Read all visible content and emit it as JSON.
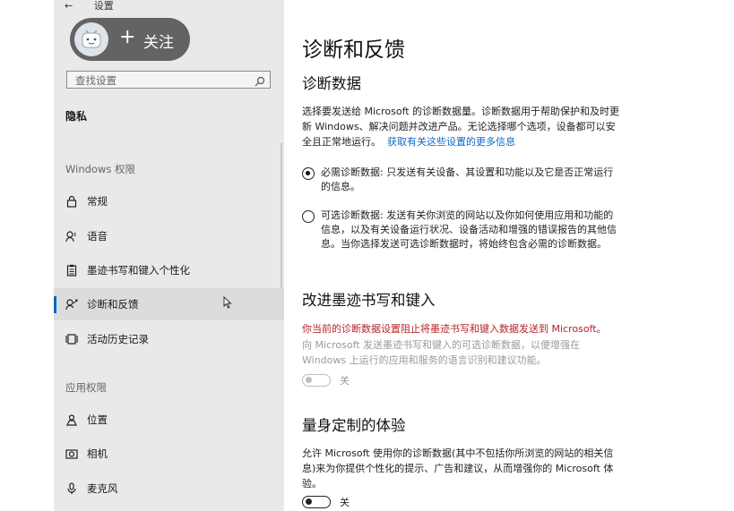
{
  "window": {
    "back_icon": "back-arrow-icon",
    "title": "设置"
  },
  "overlay": {
    "plus": "+",
    "follow_label": "关注"
  },
  "sidebar": {
    "search_placeholder": "查找设置",
    "privacy_label": "隐私",
    "windows_permissions_heading": "Windows 权限",
    "app_permissions_heading": "应用权限",
    "items": [
      {
        "label": "常规",
        "icon": "lock-icon"
      },
      {
        "label": "语音",
        "icon": "speech-icon"
      },
      {
        "label": "墨迹书写和键入个性化",
        "icon": "inking-clipboard-icon"
      },
      {
        "label": "诊断和反馈",
        "icon": "diagnostics-feedback-icon",
        "selected": true
      },
      {
        "label": "活动历史记录",
        "icon": "activity-history-icon"
      },
      {
        "label": "位置",
        "icon": "location-icon"
      },
      {
        "label": "相机",
        "icon": "camera-icon"
      },
      {
        "label": "麦克风",
        "icon": "microphone-icon"
      }
    ]
  },
  "main": {
    "title": "诊断和反馈",
    "diagnostic_data": {
      "heading": "诊断数据",
      "description_lines": [
        "选择要发送给 Microsoft 的诊断数据量。诊断数据用于帮助保护和及时更",
        "新 Windows、解决问题并改进产品。无论选择哪个选项，设备都可以安",
        "全且正常地运行。"
      ],
      "learn_more_link": "获取有关这些设置的更多信息",
      "options": [
        {
          "lines": [
            "必需诊断数据: 只发送有关设备、其设置和功能以及它是否正常运行",
            "的信息。"
          ],
          "checked": true
        },
        {
          "lines": [
            "可选诊断数据: 发送有关你浏览的网站以及你如何使用应用和功能的",
            "信息，以及有关设备运行状况、设备活动和增强的错误报告的其他信",
            "息。当你选择发送可选诊断数据时，将始终包含必需的诊断数据。"
          ],
          "checked": false
        }
      ]
    },
    "improve_inking": {
      "heading": "改进墨迹书写和键入",
      "warning": "你当前的诊断数据设置阻止将墨迹书写和键入数据发送到 Microsoft。",
      "description_lines": [
        "向 Microsoft 发送墨迹书写和键入的可选诊断数据，以便增强在",
        "Windows 上运行的应用和服务的语言识别和建议功能。"
      ],
      "toggle_label": "关",
      "toggle_on": false,
      "toggle_enabled": false
    },
    "tailored": {
      "heading": "量身定制的体验",
      "description_lines": [
        "允许 Microsoft 使用你的诊断数据(其中不包括你所浏览的网站的相关信",
        "息)来为你提供个性化的提示、广告和建议，从而增强你的 Microsoft 体",
        "验。"
      ],
      "toggle_label": "关",
      "toggle_on": false,
      "toggle_enabled": true
    }
  }
}
